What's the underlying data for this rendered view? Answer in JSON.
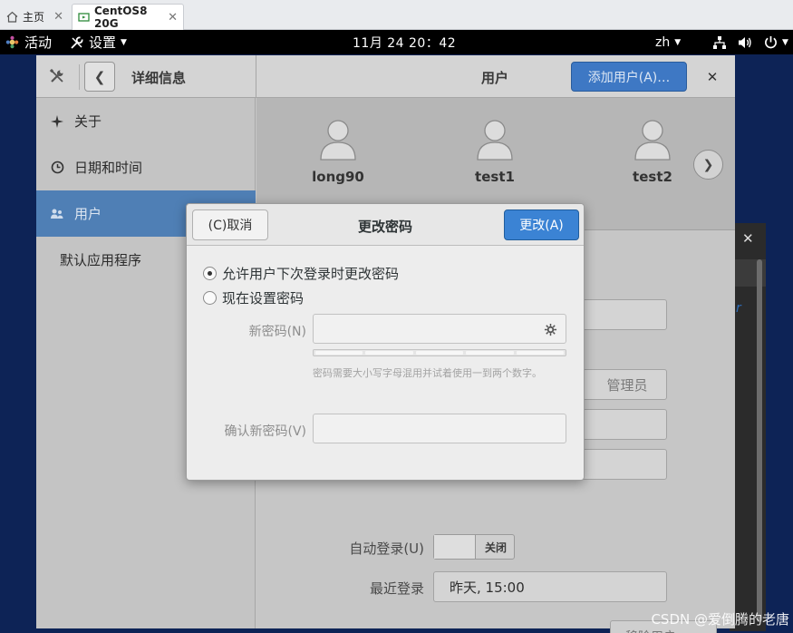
{
  "browser_tabs": [
    {
      "label": "主页"
    },
    {
      "label": "CentOS8 20G"
    }
  ],
  "topbar": {
    "activities": "活动",
    "app_menu": "设置",
    "clock": "11月 24  20：42",
    "language": "zh"
  },
  "settings": {
    "left_title": "详细信息",
    "right_title": "用户",
    "add_user_label": "添加用户(A)…",
    "sidebar": [
      {
        "label": "关于",
        "icon": "sparkle-icon"
      },
      {
        "label": "日期和时间",
        "icon": "clock-icon"
      },
      {
        "label": "用户",
        "icon": "users-icon",
        "selected": true
      },
      {
        "label": "默认应用程序"
      }
    ],
    "users": [
      {
        "name": "long90"
      },
      {
        "name": "test1"
      },
      {
        "name": "test2"
      }
    ],
    "admin_label": "管理员",
    "autologin_label": "自动登录(U)",
    "autologin_state": "关闭",
    "lastlogin_label": "最近登录",
    "lastlogin_value": "昨天, 15:00",
    "remove_user_label": "移除用户……"
  },
  "dialog": {
    "title": "更改密码",
    "cancel_label": "(C)取消",
    "change_label": "更改(A)",
    "option_allow": "允许用户下次登录时更改密码",
    "option_set_now": "现在设置密码",
    "selected_option": "option_allow",
    "new_password_label": "新密码(N)",
    "new_password_value": "",
    "hint": "密码需要大小写字母混用并试着使用一到两个数字。",
    "confirm_label": "确认新密码(V)",
    "confirm_value": ""
  },
  "background_window": {
    "visible_char": "r"
  },
  "watermark": "CSDN @爱倒腾的老唐",
  "colors": {
    "accent": "#3b83d4",
    "sidebar_selected": "#4f7fb5",
    "desktop": "#0d2356"
  }
}
